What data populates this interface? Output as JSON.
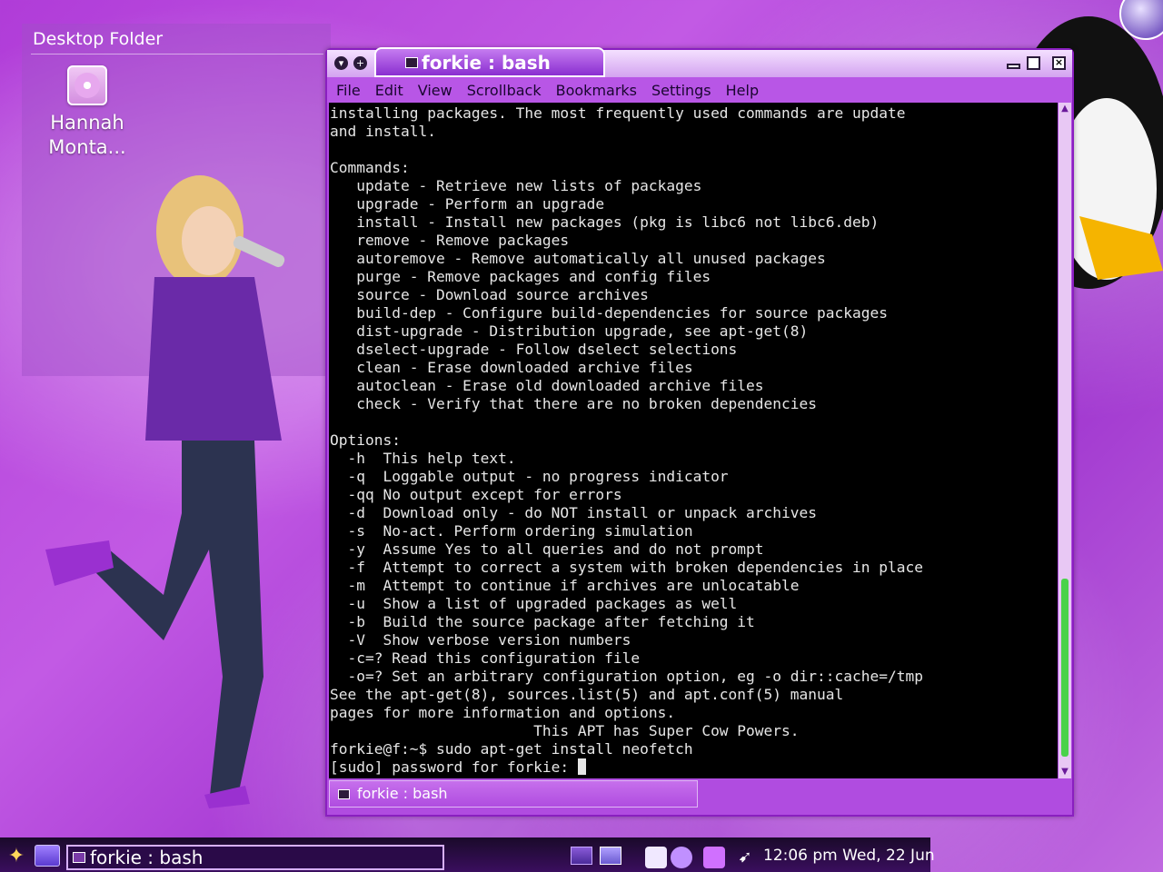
{
  "desktop": {
    "folder_title": "Desktop Folder",
    "icon_label_line1": "Hannah",
    "icon_label_line2": "Monta..."
  },
  "window": {
    "tab_title": "forkie : bash",
    "menu": [
      "File",
      "Edit",
      "View",
      "Scrollback",
      "Bookmarks",
      "Settings",
      "Help"
    ],
    "status_tab": "forkie : bash"
  },
  "terminal": {
    "lines": [
      "installing packages. The most frequently used commands are update",
      "and install.",
      "",
      "Commands:",
      "   update - Retrieve new lists of packages",
      "   upgrade - Perform an upgrade",
      "   install - Install new packages (pkg is libc6 not libc6.deb)",
      "   remove - Remove packages",
      "   autoremove - Remove automatically all unused packages",
      "   purge - Remove packages and config files",
      "   source - Download source archives",
      "   build-dep - Configure build-dependencies for source packages",
      "   dist-upgrade - Distribution upgrade, see apt-get(8)",
      "   dselect-upgrade - Follow dselect selections",
      "   clean - Erase downloaded archive files",
      "   autoclean - Erase old downloaded archive files",
      "   check - Verify that there are no broken dependencies",
      "",
      "Options:",
      "  -h  This help text.",
      "  -q  Loggable output - no progress indicator",
      "  -qq No output except for errors",
      "  -d  Download only - do NOT install or unpack archives",
      "  -s  No-act. Perform ordering simulation",
      "  -y  Assume Yes to all queries and do not prompt",
      "  -f  Attempt to correct a system with broken dependencies in place",
      "  -m  Attempt to continue if archives are unlocatable",
      "  -u  Show a list of upgraded packages as well",
      "  -b  Build the source package after fetching it",
      "  -V  Show verbose version numbers",
      "  -c=? Read this configuration file",
      "  -o=? Set an arbitrary configuration option, eg -o dir::cache=/tmp",
      "See the apt-get(8), sources.list(5) and apt.conf(5) manual",
      "pages for more information and options.",
      "                       This APT has Super Cow Powers.",
      "forkie@f:~$ sudo apt-get install neofetch"
    ],
    "prompt_line": "[sudo] password for forkie: "
  },
  "taskbar": {
    "task_label": "forkie : bash",
    "clock": "12:06 pm Wed, 22 Jun"
  },
  "colors": {
    "accent": "#b04ce0",
    "terminal_bg": "#000000",
    "scroll_thumb": "#4ad24a"
  }
}
